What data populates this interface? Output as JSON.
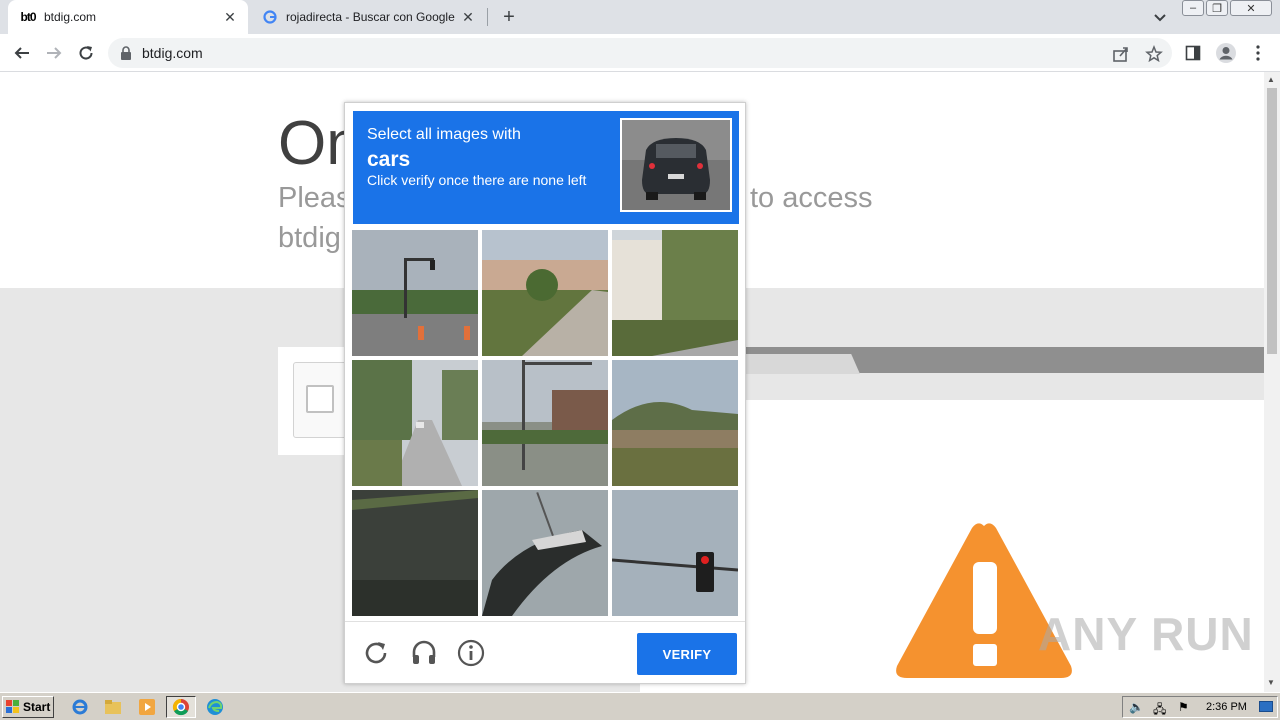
{
  "browser": {
    "tabs": [
      {
        "label": "btdig.com",
        "favicon": "bt0",
        "active": true
      },
      {
        "label": "rojadirecta - Buscar con Google",
        "favicon": "google-icon",
        "active": false
      }
    ],
    "address": "btdig.com"
  },
  "page": {
    "heading": "On",
    "sub_left": "Pleas",
    "sub_right": "to access",
    "sub_line2": "btdig"
  },
  "captcha": {
    "instruction_line1": "Select all images with",
    "target": "cars",
    "instruction_line2": "Click verify once there are none left",
    "verify_label": "VERIFY"
  },
  "watermark": "ANY RUN",
  "taskbar": {
    "start_label": "Start",
    "clock": "2:36 PM"
  },
  "colors": {
    "captcha_blue": "#1a73e8",
    "warning_orange": "#f5922f"
  }
}
